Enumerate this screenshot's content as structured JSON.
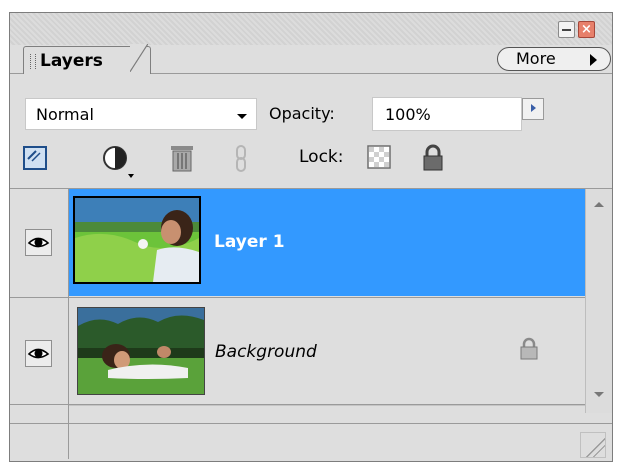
{
  "panel": {
    "tab_label": "Layers",
    "more_label": "More",
    "blend_mode": "Normal",
    "opacity_label": "Opacity:",
    "opacity_value": "100%",
    "lock_label": "Lock:"
  },
  "layers": [
    {
      "name": "Layer 1",
      "selected": true,
      "visible": true,
      "locked": false
    },
    {
      "name": "Background",
      "selected": false,
      "visible": true,
      "locked": true
    }
  ],
  "colors": {
    "selection": "#3399ff",
    "panel_bg": "#dedede",
    "close_button": "#e7806b"
  },
  "icons": {
    "minimize": "minimize-icon",
    "close": "close-icon",
    "more_arrow": "triangle-right-icon",
    "new_layer": "new-layer-icon",
    "adjustment": "adjustment-layer-icon",
    "delete": "trash-icon",
    "link": "link-icon",
    "lock_transparency": "lock-transparency-icon",
    "lock_all": "padlock-icon",
    "visibility": "eye-icon"
  }
}
